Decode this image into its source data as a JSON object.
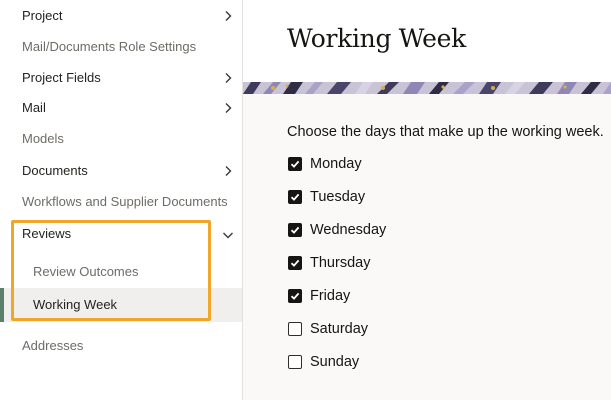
{
  "sidebar": {
    "items": [
      {
        "label": "Project",
        "icon": "chevron-right-icon"
      },
      {
        "label": "Mail/Documents Role Settings"
      },
      {
        "label": "Project Fields",
        "icon": "chevron-right-icon"
      },
      {
        "label": "Mail",
        "icon": "chevron-right-icon"
      },
      {
        "label": "Models"
      },
      {
        "label": "Documents",
        "icon": "chevron-right-icon"
      },
      {
        "label": "Workflows and Supplier Documents"
      },
      {
        "label": "Reviews",
        "icon": "chevron-down-icon",
        "expanded": true,
        "children": [
          {
            "label": "Review Outcomes"
          },
          {
            "label": "Working Week",
            "selected": true
          }
        ]
      },
      {
        "label": "Addresses"
      }
    ]
  },
  "main": {
    "title": "Working Week",
    "instructions": "Choose the days that make up the working week.",
    "days": [
      {
        "label": "Monday",
        "checked": true
      },
      {
        "label": "Tuesday",
        "checked": true
      },
      {
        "label": "Wednesday",
        "checked": true
      },
      {
        "label": "Thursday",
        "checked": true
      },
      {
        "label": "Friday",
        "checked": true
      },
      {
        "label": "Saturday",
        "checked": false
      },
      {
        "label": "Sunday",
        "checked": false
      }
    ]
  },
  "colors": {
    "accent_selected_bar": "#5c7f6b",
    "highlight_outline": "#f0a62a",
    "checkbox_checked": "#161513"
  }
}
